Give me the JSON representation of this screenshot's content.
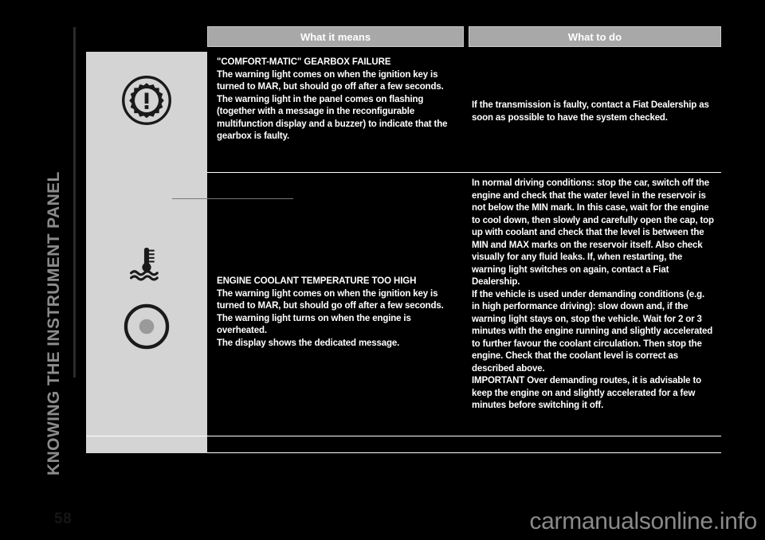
{
  "chapter": {
    "title": "KNOWING THE INSTRUMENT PANEL"
  },
  "page": {
    "number": "58",
    "watermark": "carmanualsonline.info"
  },
  "table": {
    "headers": {
      "what_it_means": "What it means",
      "what_to_do": "What to do"
    },
    "rows": [
      {
        "icon_name": "gearbox-failure-warning-icon",
        "what_it_means": {
          "title": "\"COMFORT-MATIC\" GEARBOX FAILURE",
          "paragraphs": [
            "The warning light comes on when the ignition key is turned to MAR, but should go off after a few seconds.",
            "The warning light in the panel comes on flashing (together with a message in the reconfigurable multifunction display and a buzzer) to indicate that the gearbox is faulty."
          ]
        },
        "what_to_do": {
          "paragraphs": [
            "If the transmission is faulty, contact a Fiat Dealership as soon as possible to have the system checked."
          ]
        }
      },
      {
        "icon_name": "engine-coolant-temperature-icon",
        "icon_name_secondary": "coolant-level-circle-icon",
        "what_it_means": {
          "title": "ENGINE COOLANT TEMPERATURE TOO HIGH",
          "paragraphs": [
            "The warning light comes on when the ignition key is turned to MAR, but should go off after a few seconds.",
            "The warning light turns on when the engine is overheated.",
            "The display shows the dedicated message."
          ]
        },
        "what_to_do": {
          "paragraphs": [
            "In normal driving conditions: stop the car, switch off the engine and check that the water level in the reservoir is not below the MIN mark. In this case, wait for the engine to cool down, then slowly and carefully open the cap, top up with coolant and check that the level is between the MIN and MAX marks on the reservoir itself. Also check visually for any fluid leaks. If, when restarting, the warning light switches on again, contact a Fiat Dealership.",
            "If the vehicle is used under demanding conditions (e.g. in high performance driving): slow down and, if the warning light stays on, stop the vehicle. Wait for 2 or 3 minutes with the engine running and slightly accelerated to further favour the coolant circulation. Then stop the engine. Check that the coolant level is correct as described above.",
            "IMPORTANT Over demanding routes, it is advisable to keep the engine on and slightly accelerated for a few minutes before switching it off."
          ]
        }
      }
    ]
  },
  "colors": {
    "page_background": "#000000",
    "header_cell": "#a8a8a8",
    "icon_panel": "#d4d4d4",
    "text": "#ffffff",
    "chapter_title": "#8c8c8c",
    "watermark": "#8a8a8a"
  }
}
